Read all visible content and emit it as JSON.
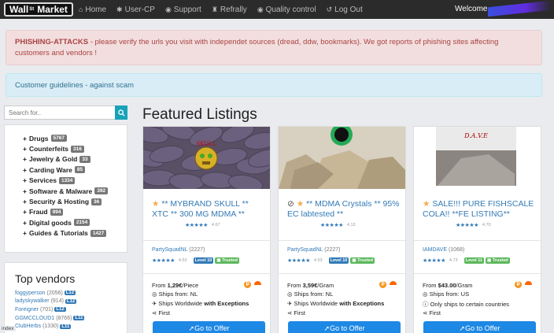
{
  "navbar": {
    "logo_pre": "Wall",
    "logo_sup": "St",
    "logo_post": "Market",
    "items": [
      {
        "icon": "home-icon",
        "glyph": "⌂",
        "label": "Home"
      },
      {
        "icon": "tools-icon",
        "glyph": "✱",
        "label": "User-CP"
      },
      {
        "icon": "support-icon",
        "glyph": "◉",
        "label": "Support"
      },
      {
        "icon": "trash-icon",
        "glyph": "♜",
        "label": "Refrally"
      },
      {
        "icon": "check-icon",
        "glyph": "◉",
        "label": "Quality control"
      },
      {
        "icon": "logout-icon",
        "glyph": "↺",
        "label": "Log Out"
      }
    ],
    "welcome": "Welcome"
  },
  "alerts": {
    "phishing_title": "PHISHING-ATTACKS",
    "phishing_text": " - please verify the urls you visit with independet sources (dread, ddw, bookmarks). We got reports of phishing sites affecting customers and vendors !",
    "guidelines": "Customer guidelines - against scam"
  },
  "search": {
    "placeholder": "Search for..",
    "icon": "search-icon"
  },
  "categories": [
    {
      "label": "Drugs",
      "count": "5767"
    },
    {
      "label": "Counterfeits",
      "count": "316"
    },
    {
      "label": "Jewelry & Gold",
      "count": "33"
    },
    {
      "label": "Carding Ware",
      "count": "85"
    },
    {
      "label": "Services",
      "count": "1334"
    },
    {
      "label": "Software & Malware",
      "count": "392"
    },
    {
      "label": "Security & Hosting",
      "count": "36"
    },
    {
      "label": "Fraud",
      "count": "994"
    },
    {
      "label": "Digital goods",
      "count": "2154"
    },
    {
      "label": "Guides & Tutorials",
      "count": "1427"
    }
  ],
  "top_vendors": {
    "title": "Top vendors",
    "items": [
      {
        "name": "foggyperson",
        "count": "(2056)",
        "level": "L12"
      },
      {
        "name": "ladyskywalker",
        "count": "(914)",
        "level": "L12"
      },
      {
        "name": "Foreigner",
        "count": "(701)",
        "level": "L12"
      },
      {
        "name": "GGMCCLOUD1",
        "count": "(8766)",
        "level": "L11"
      },
      {
        "name": "ClubHerbs",
        "count": "(1330)",
        "level": "L11"
      }
    ]
  },
  "index_label": "index",
  "featured": {
    "title": "Featured Listings",
    "cards": [
      {
        "title": "** MYBRAND SKULL ** XTC ** 300 MG MDMA **",
        "rating": "4.67",
        "vendor": "PartySquadNL",
        "vendor_count": "(2227)",
        "vendor_rating": "4.53",
        "level": "Level 10",
        "trusted": "Trusted",
        "price_prefix": "From ",
        "price": "1,29€",
        "unit": "/Piece",
        "ships_from": "Ships from: NL",
        "ships_to_a": "Ships Worldwide ",
        "ships_to_b": "with Exceptions",
        "shipping": "First",
        "button": "Go to Offer",
        "img_label": "SKULL"
      },
      {
        "title": "** MDMA Crystals ** 95% EC labtested **",
        "rating": "4.13",
        "vendor": "PartySquadNL",
        "vendor_count": "(2227)",
        "vendor_rating": "4.53",
        "level": "Level 10",
        "trusted": "Trusted",
        "price_prefix": "From ",
        "price": "3,59€",
        "unit": "/Gram",
        "ships_from": "Ships from: NL",
        "ships_to_a": "Ships Worldwide ",
        "ships_to_b": "with Exceptions",
        "shipping": "First",
        "button": "Go to Offer"
      },
      {
        "title": "SALE!!! PURE FISHSCALE COLA!! **FE LISTING**",
        "rating": "4.70",
        "vendor": "IAMDAVE",
        "vendor_count": "(1068)",
        "vendor_rating": "4.73",
        "level": "Level 11",
        "trusted": "Trusted",
        "price_prefix": "From ",
        "price": "$43.00",
        "unit": "/Gram",
        "ships_from": "Ships from: US",
        "ships_to_a": "Only ships to certain countries",
        "ships_to_b": "",
        "shipping": "First",
        "button": "Go to Offer",
        "img_label": "D.A.V.E"
      }
    ]
  },
  "colors": {
    "navbar": "#2b2b2b",
    "link": "#337ab7",
    "button": "#1e88e5",
    "star": "#f0ad4e",
    "trusted": "#5cb85c"
  }
}
